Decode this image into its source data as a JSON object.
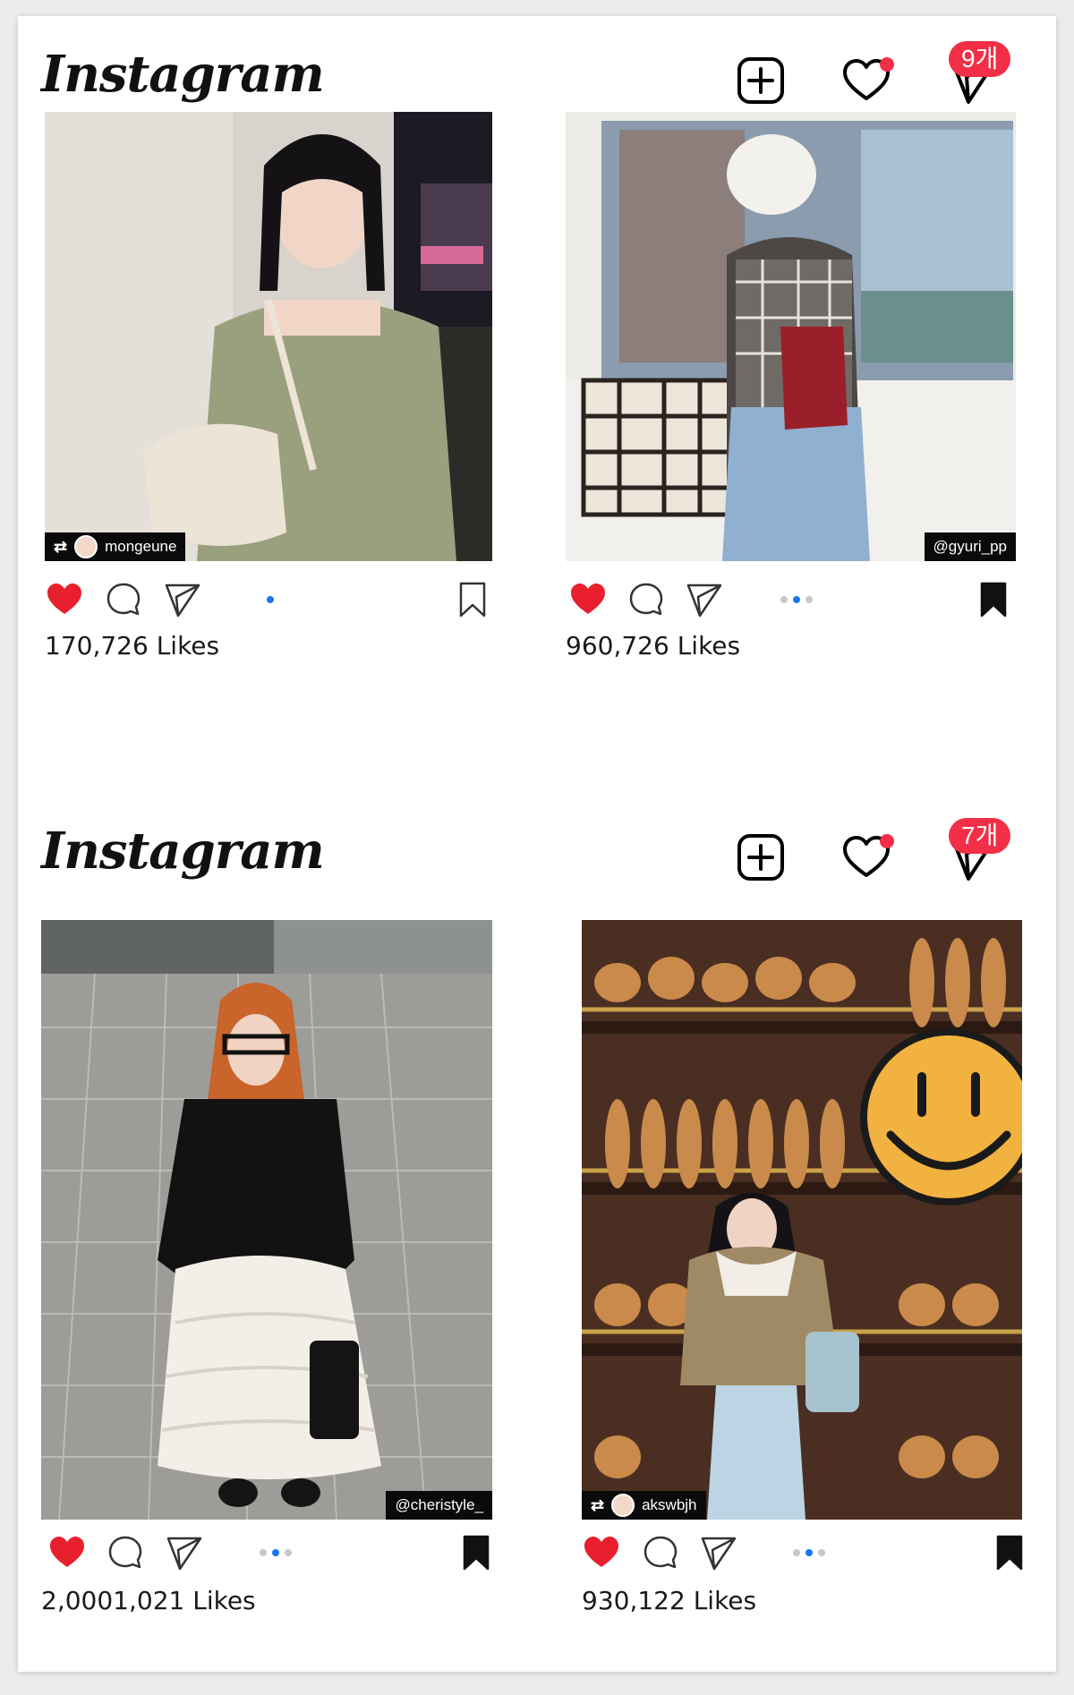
{
  "sections": [
    {
      "brand": "Instagram",
      "message_badge": "9개",
      "posts": [
        {
          "tag": "mongeune",
          "likes": "170,726 Likes"
        },
        {
          "tag": "@gyuri_pp",
          "likes": "960,726 Likes"
        }
      ]
    },
    {
      "brand": "Instagram",
      "message_badge": "7개",
      "posts": [
        {
          "tag": "@cheristyle_",
          "likes": "2,0001,021 Likes"
        },
        {
          "tag": "akswbjh",
          "likes": "930,122 Likes"
        }
      ]
    }
  ],
  "colors": {
    "like_red": "#e8202d",
    "badge_red": "#f22f46",
    "active_dot": "#1877f2"
  },
  "icons": [
    "add-post-icon",
    "notifications-heart-icon",
    "direct-message-icon",
    "like-heart-icon",
    "comment-icon",
    "share-icon",
    "bookmark-icon",
    "repost-icon"
  ]
}
